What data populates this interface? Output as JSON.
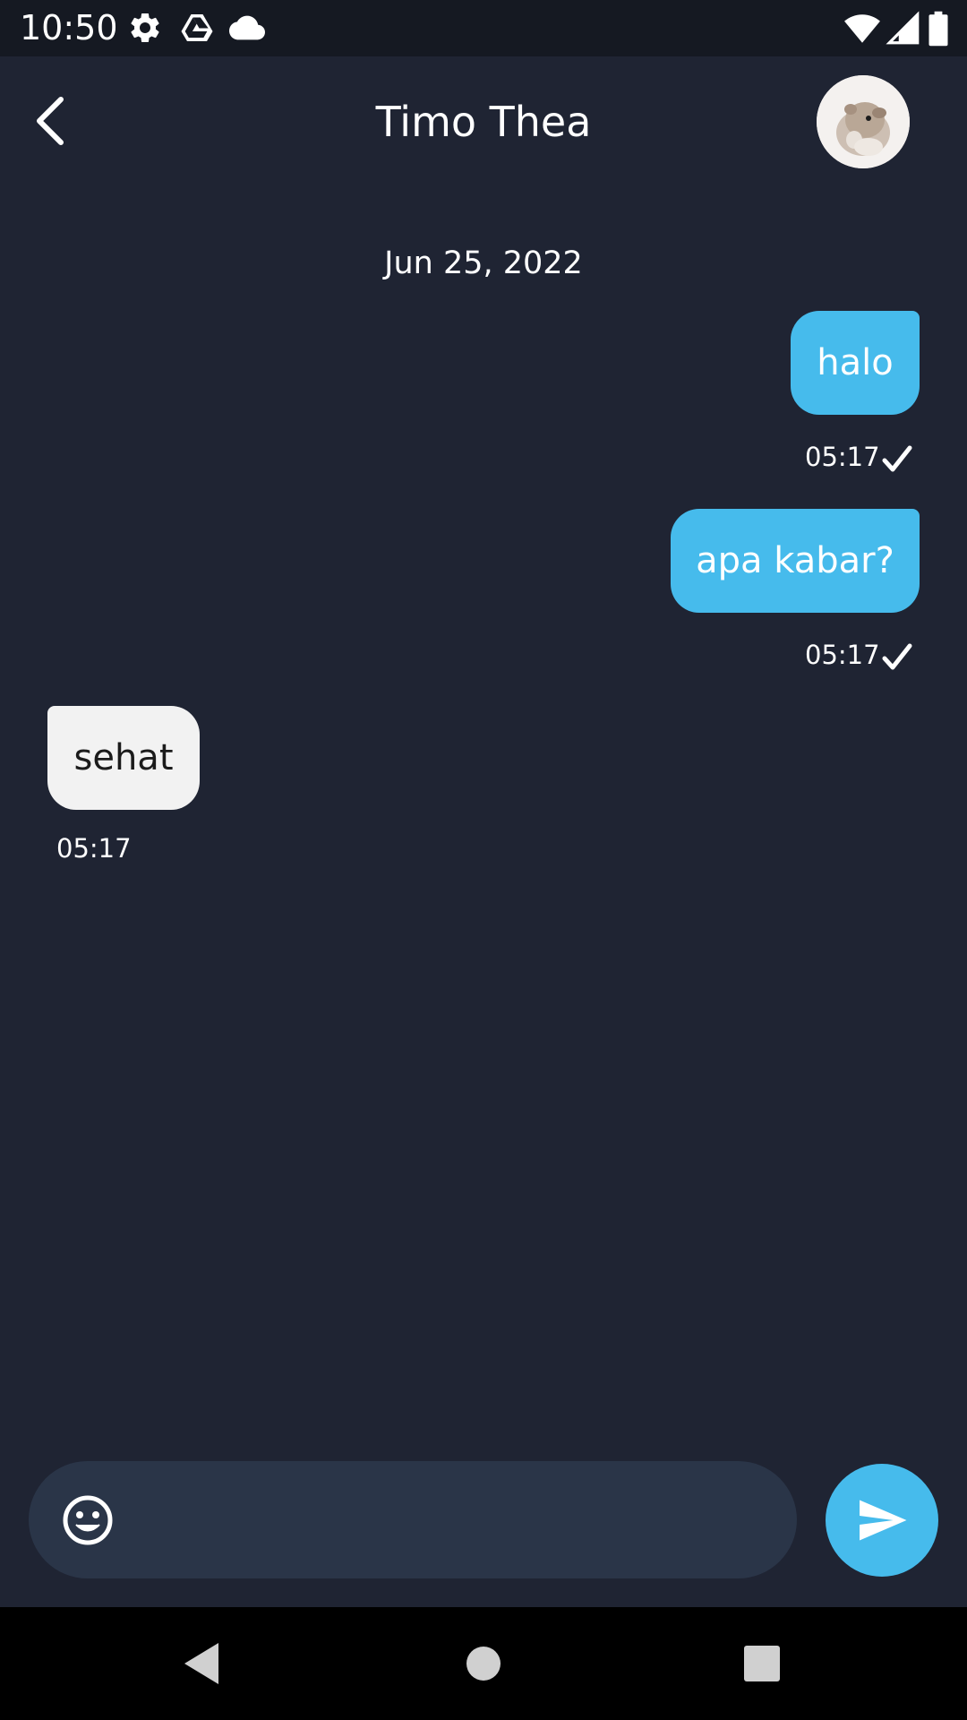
{
  "status_bar": {
    "time": "10:50",
    "left_icons": [
      "gear-icon",
      "drive-icon",
      "cloud-icon"
    ],
    "right_icons": [
      "wifi-icon",
      "signal-icon",
      "battery-icon"
    ]
  },
  "header": {
    "contact_name": "Timo Thea",
    "back_icon": "chevron-left-icon",
    "avatar": "contact-avatar-hamster"
  },
  "chat": {
    "date_separator": "Jun 25, 2022",
    "messages": [
      {
        "direction": "outgoing",
        "text": "halo",
        "time": "05:17",
        "status_icon": "check-icon"
      },
      {
        "direction": "outgoing",
        "text": "apa kabar?",
        "time": "05:17",
        "status_icon": "check-icon"
      },
      {
        "direction": "incoming",
        "text": "sehat",
        "time": "05:17"
      }
    ]
  },
  "composer": {
    "value": "",
    "placeholder": "",
    "emoji_icon": "emoji-icon",
    "send_icon": "send-icon"
  },
  "nav_bar": {
    "buttons": [
      "back-triangle-icon",
      "home-circle-icon",
      "recents-square-icon"
    ]
  },
  "colors": {
    "background": "#1f2433",
    "status_bar": "#151922",
    "outgoing_bubble": "#46bbec",
    "incoming_bubble": "#f2f2f2",
    "composer": "#2a3548",
    "accent": "#46bbec"
  }
}
